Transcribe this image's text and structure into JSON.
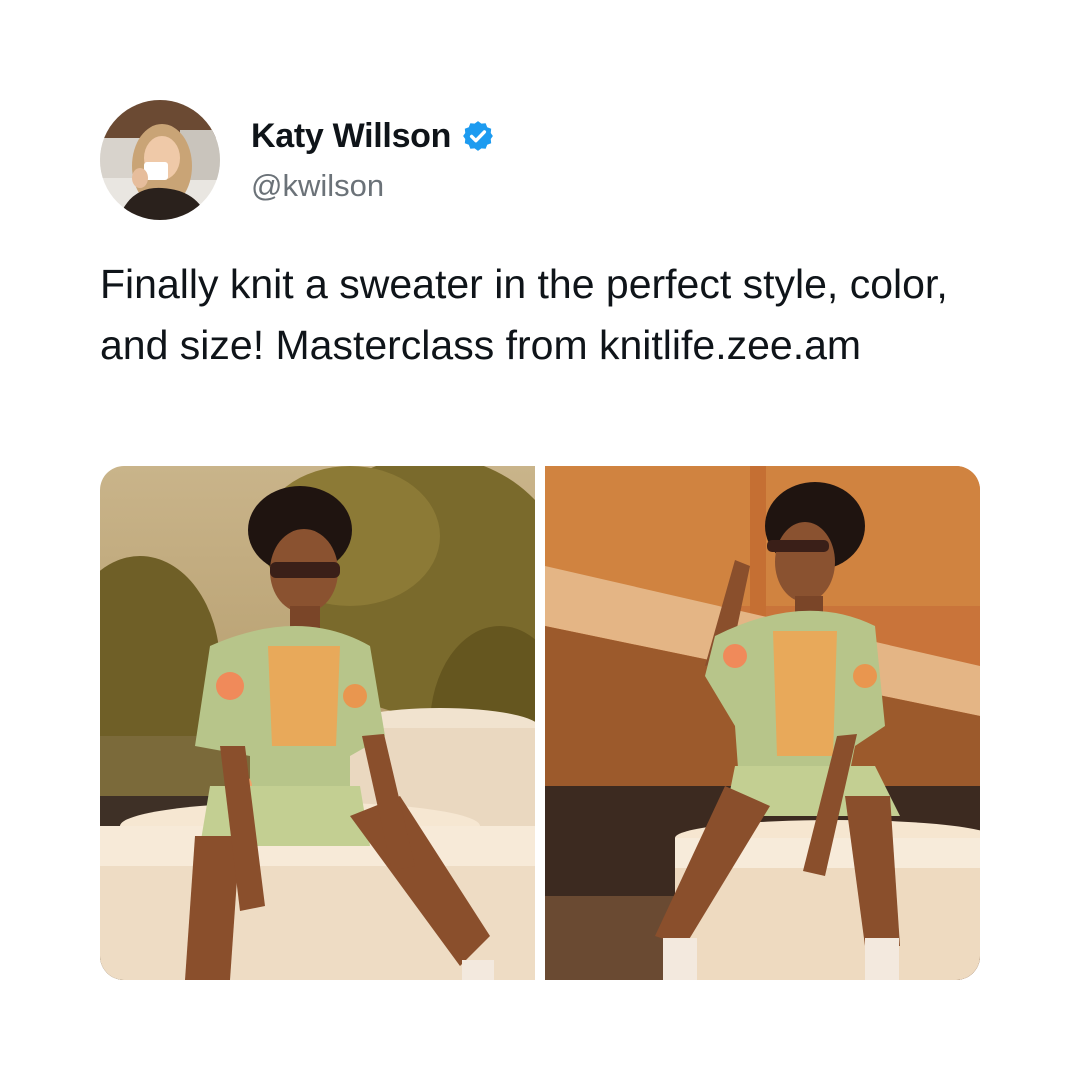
{
  "user": {
    "display_name": "Katy Willson",
    "handle": "@kwilson",
    "verified": true,
    "avatar_icon": "profile-photo-woman-drinking-coffee"
  },
  "tweet": {
    "text": "Finally knit a sweater in the perfect style, color, and size! Masterclass from knitlife.zee.am"
  },
  "media": [
    {
      "description_icon": "photo-person-seated-smiling-sunglasses"
    },
    {
      "description_icon": "photo-person-seated-adjusting-sunglasses"
    }
  ],
  "colors": {
    "verified_badge": "#1d9bf0",
    "handle_text": "#6b7278",
    "primary_text": "#0f1419"
  }
}
